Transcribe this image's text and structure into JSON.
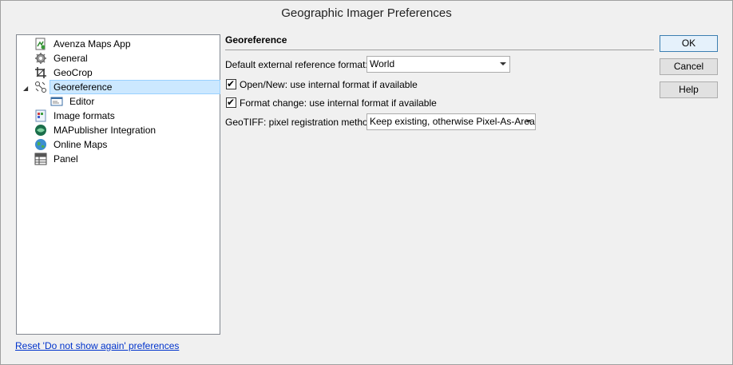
{
  "window": {
    "title": "Geographic Imager Preferences"
  },
  "tree": {
    "items": [
      {
        "label": "Avenza Maps App",
        "icon": "avenza-maps-icon"
      },
      {
        "label": "General",
        "icon": "gear-icon"
      },
      {
        "label": "GeoCrop",
        "icon": "crop-icon"
      },
      {
        "label": "Georeference",
        "icon": "georeference-icon",
        "selected": true,
        "expanded": true
      },
      {
        "label": "Editor",
        "icon": "editor-icon",
        "child": true
      },
      {
        "label": "Image formats",
        "icon": "image-formats-icon"
      },
      {
        "label": "MAPublisher Integration",
        "icon": "mapublisher-icon"
      },
      {
        "label": "Online Maps",
        "icon": "globe-icon"
      },
      {
        "label": "Panel",
        "icon": "panel-icon"
      }
    ]
  },
  "reset_link": "Reset 'Do not show again' preferences",
  "section": {
    "title": "Georeference",
    "default_format_label": "Default external reference format:",
    "default_format_value": "World",
    "open_new_label": "Open/New: use internal format if available",
    "open_new_checked": true,
    "format_change_label": "Format change: use internal format if available",
    "format_change_checked": true,
    "geotiff_label": "GeoTIFF: pixel registration method:",
    "geotiff_value": "Keep existing, otherwise Pixel-As-Area"
  },
  "buttons": {
    "ok": "OK",
    "cancel": "Cancel",
    "help": "Help"
  },
  "colors": {
    "selection": "#cce8ff",
    "link": "#0033cc",
    "default_button_border": "#3c7fb1"
  }
}
